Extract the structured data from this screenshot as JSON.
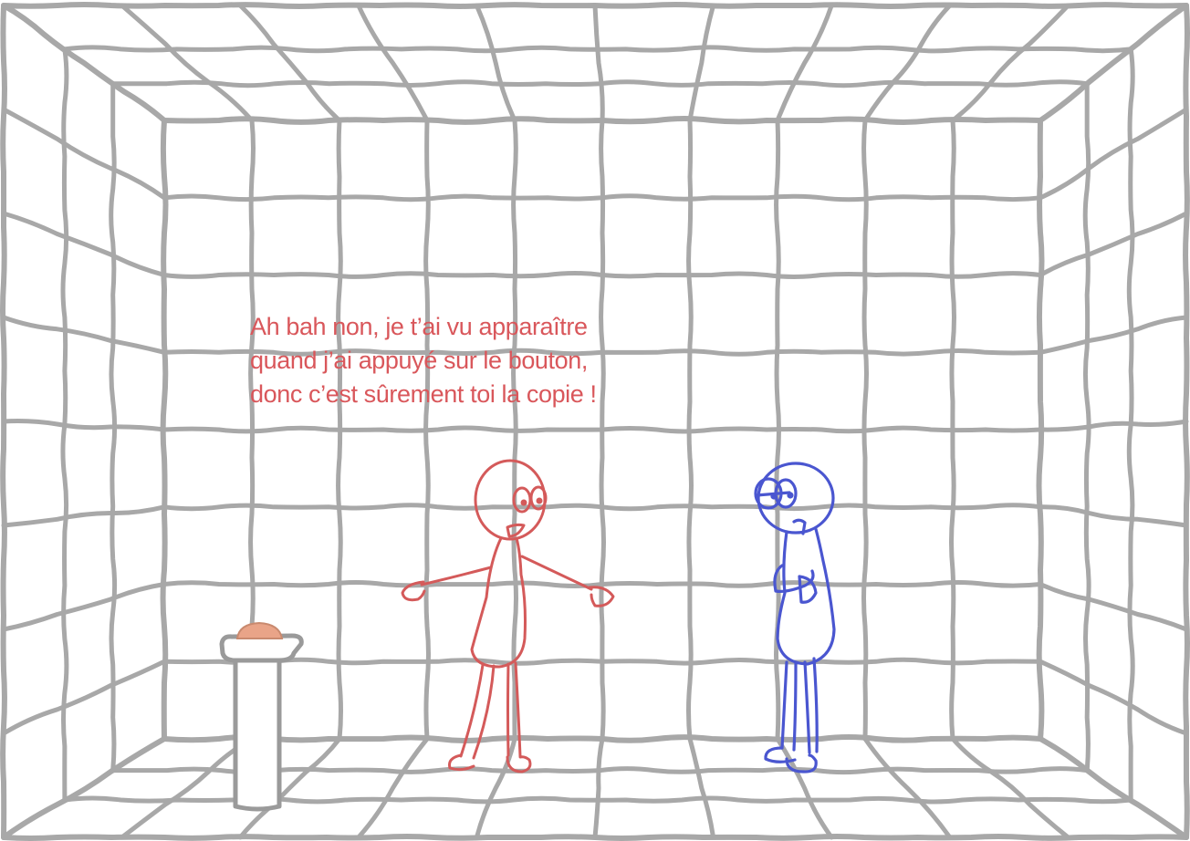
{
  "speech": {
    "lines": [
      "Ah bah non, je t’ai vu apparaître",
      "quand j’ai appuyé sur le bouton,",
      "donc c’est sûrement toi la copie !"
    ]
  },
  "colors": {
    "grid": "#a8a8a8",
    "paper": "#ffffff",
    "red_character": "#d45a5a",
    "blue_character": "#4a56d0",
    "speech_text": "#d9575b",
    "button_dome": "#e9a488",
    "pedestal": "#9a9a9a"
  },
  "characters": [
    {
      "name": "red-character",
      "color_key": "red_character",
      "pose": "arms-open-speaking"
    },
    {
      "name": "blue-character",
      "color_key": "blue_character",
      "pose": "arms-crossed-doubtful"
    }
  ],
  "props": [
    "button-pedestal",
    "button-icon"
  ]
}
